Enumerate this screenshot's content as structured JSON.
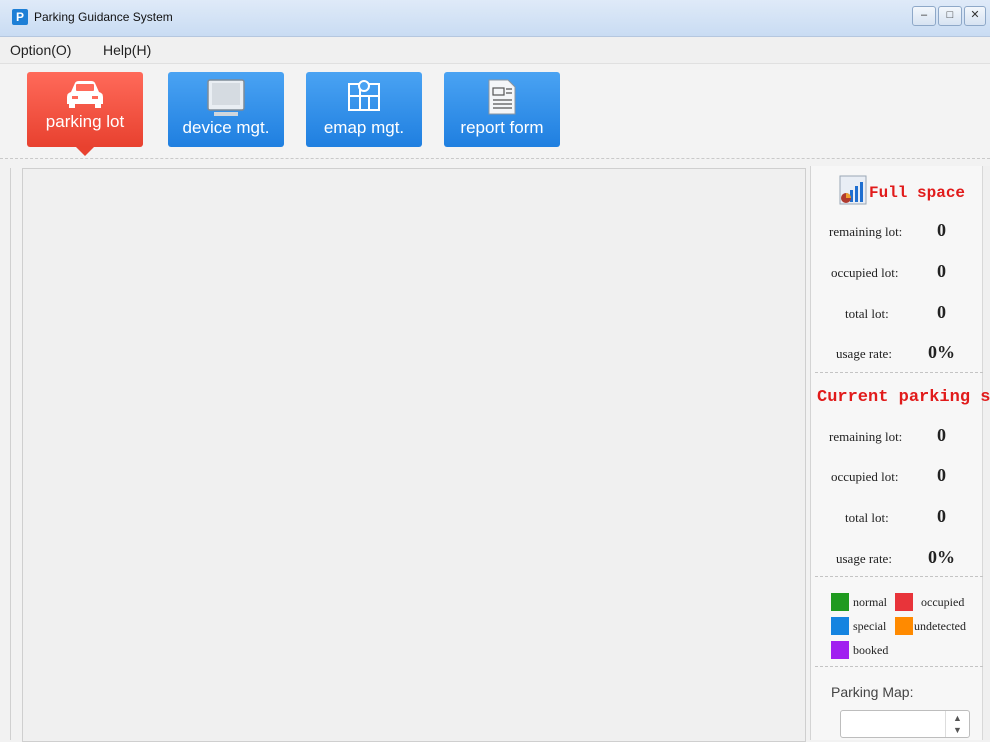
{
  "window": {
    "title": "Parking Guidance System",
    "app_icon": "P"
  },
  "menu": {
    "items": [
      {
        "label": "Option(O)"
      },
      {
        "label": "Help(H)"
      }
    ]
  },
  "toolbar": {
    "buttons": [
      {
        "label": "parking lot",
        "icon": "car-icon",
        "active": true
      },
      {
        "label": "device mgt.",
        "icon": "monitor-icon",
        "active": false
      },
      {
        "label": "emap mgt.",
        "icon": "map-icon",
        "active": false
      },
      {
        "label": "report form",
        "icon": "document-icon",
        "active": false
      }
    ]
  },
  "full_space": {
    "title": "Full space",
    "remaining_label": "remaining lot:",
    "remaining": "0",
    "occupied_label": "occupied lot:",
    "occupied": "0",
    "total_label": "total lot:",
    "total": "0",
    "usage_label": "usage rate:",
    "usage": "0%"
  },
  "current_space": {
    "title": "Current parking s",
    "remaining_label": "remaining lot:",
    "remaining": "0",
    "occupied_label": "occupied lot:",
    "occupied": "0",
    "total_label": "total lot:",
    "total": "0",
    "usage_label": "usage rate:",
    "usage": "0%"
  },
  "legend": [
    {
      "label": "normal",
      "color": "#1f9a1f"
    },
    {
      "label": "occupied",
      "color": "#e8343a"
    },
    {
      "label": "special",
      "color": "#1584e0"
    },
    {
      "label": "undetected",
      "color": "#ff8a00"
    },
    {
      "label": "booked",
      "color": "#a020f0"
    }
  ],
  "parking_map": {
    "label": "Parking Map:",
    "selected": ""
  },
  "colors": {
    "accent_active": "#e8412f",
    "accent": "#1f7fe0",
    "section_title": "#e11b1b"
  }
}
